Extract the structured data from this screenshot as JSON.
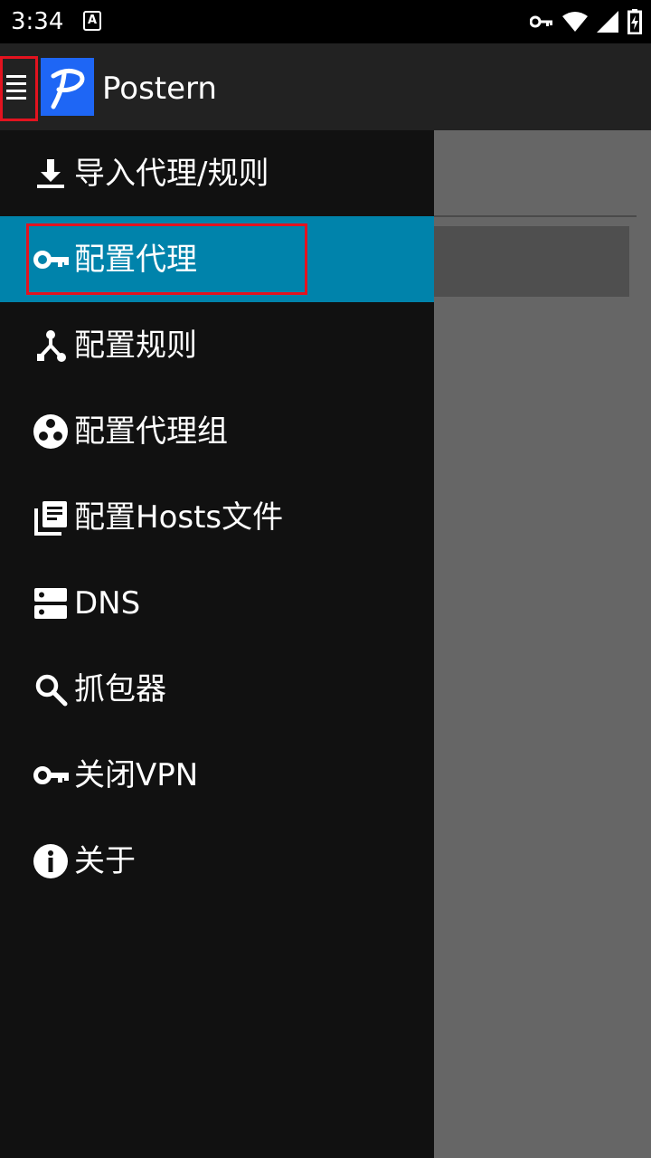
{
  "status_bar": {
    "time": "3:34",
    "icons": [
      "a-notification-icon",
      "vpn-key-icon",
      "wifi-icon",
      "signal-icon",
      "battery-charging-icon"
    ]
  },
  "app_bar": {
    "title": "Postern",
    "menu_icon": "hamburger-menu-icon",
    "logo": "postern-logo"
  },
  "drawer": {
    "items": [
      {
        "label": "导入代理/规则",
        "icon": "download-icon",
        "active": false
      },
      {
        "label": "配置代理",
        "icon": "key-icon",
        "active": true
      },
      {
        "label": "配置规则",
        "icon": "fork-icon",
        "active": false
      },
      {
        "label": "配置代理组",
        "icon": "group-icon",
        "active": false
      },
      {
        "label": "配置Hosts文件",
        "icon": "library-icon",
        "active": false
      },
      {
        "label": "DNS",
        "icon": "dns-icon",
        "active": false
      },
      {
        "label": "抓包器",
        "icon": "search-icon",
        "active": false
      },
      {
        "label": "关闭VPN",
        "icon": "key-icon",
        "active": false
      },
      {
        "label": "关于",
        "icon": "info-icon",
        "active": false
      }
    ]
  },
  "colors": {
    "active_item": "#0083ab",
    "drawer_bg": "#111111",
    "app_bar_bg": "#222222",
    "logo_bg": "#1e66f5",
    "annotation_red": "#e3131f"
  }
}
